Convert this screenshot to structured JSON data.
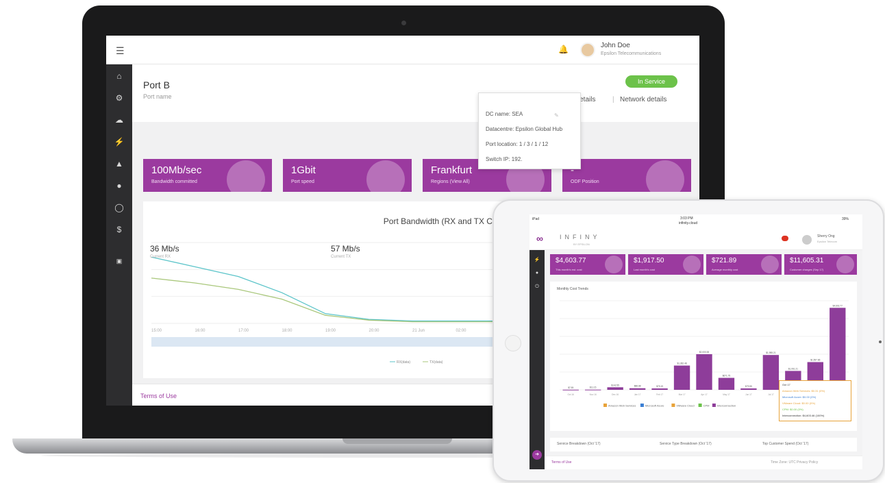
{
  "laptop": {
    "user": {
      "name": "John Doe",
      "company": "Epsilon Telecommunications"
    },
    "port": {
      "title": "Port B",
      "subtitle": "Port name"
    },
    "service_button": "In Service",
    "more_details": "More details",
    "network_details": "Network details",
    "popover": [
      "DC name: SEA",
      "Datacentre: Epsilon Global Hub",
      "Port location: 1 / 3 / 1 / 12",
      "Switch IP: 192."
    ],
    "stats": [
      {
        "value": "100Mb/sec",
        "label": "Bandwidth committed"
      },
      {
        "value": "1Gbit",
        "label": "Port speed"
      },
      {
        "value": "Frankfurt",
        "label": "Regions (View All)"
      },
      {
        "value": "-",
        "label": "ODF Position"
      }
    ],
    "chart_data": {
      "type": "line",
      "title": "Port Bandwidth (RX and TX Combined)",
      "x": [
        "15:00",
        "16:00",
        "17:00",
        "18:00",
        "19:00",
        "20:00",
        "21 Jun",
        "02:00",
        "03:00"
      ],
      "series": [
        {
          "name": "RX(data)",
          "values": [
            82,
            70,
            58,
            38,
            12,
            5,
            3,
            3,
            3
          ]
        },
        {
          "name": "TX(data)",
          "values": [
            56,
            50,
            42,
            30,
            10,
            4,
            2,
            2,
            2
          ]
        }
      ],
      "ylim": [
        0,
        100
      ]
    },
    "current": [
      {
        "value": "36 Mb/s",
        "label": "Current RX"
      },
      {
        "value": "57 Mb/s",
        "label": "Current TX"
      }
    ],
    "terms": "Terms of Use"
  },
  "tablet": {
    "status": {
      "left": "iPad",
      "time": "3:03 PM",
      "net": "infinity.cloud",
      "battery": "39%"
    },
    "brand": "INFINY",
    "brand_sub": "BY EPSILON",
    "user": {
      "name": "Sherry Ong",
      "company": "Epsilon Telecom"
    },
    "stats": [
      {
        "value": "$4,603.77",
        "label": "This month's est. cost"
      },
      {
        "value": "$1,917.50",
        "label": "Last month's cost"
      },
      {
        "value": "$721.89",
        "label": "Average monthly cost"
      },
      {
        "value": "$11,605.31",
        "label": "Customer charges (Sep 17)"
      }
    ],
    "chart_data": {
      "type": "bar",
      "title": "Monthly Cost Trends",
      "categories": [
        "Oct 16",
        "Nov 16",
        "Dec 16",
        "Jan 17",
        "Feb 17",
        "Mar 17",
        "Apr 17",
        "May 17",
        "Jun 17",
        "Jul 17",
        "Aug 17",
        "Sep 17",
        "Oct 17"
      ],
      "values": [
        7.55,
        11.15,
        142.55,
        88.88,
        79.19,
        1362.48,
        2000.38,
        671.75,
        79.55,
        1955.21,
        1061.21,
        1557.86,
        4603.77
      ],
      "data_labels": [
        "$7.55",
        "$11.15",
        "$142.55",
        "$88.88",
        "$79.19",
        "$1,362.48",
        "$2,000.38",
        "$671.75",
        "$79.55",
        "$1,955.21",
        "$1,061.21",
        "$1,557.86",
        "$4,603.77"
      ],
      "legend": [
        "Amazon Web Services",
        "Microsoft Azure",
        "VMware Cloud",
        "CPM",
        "Interconnection"
      ],
      "ylim": [
        0,
        5000
      ]
    },
    "tooltip": {
      "title": "Oct 17",
      "rows": [
        "Amazon Web Services: $0.31 (0%)",
        "Microsoft Azure: $0.00 (0%)",
        "VMware Cloud: $0.00 (0%)",
        "CPM: $0.00 (0%)",
        "Interconnection: $4,603.46 (100%)"
      ]
    },
    "bottom": [
      "Service Breakdown (Oct '17)",
      "Service Type Breakdown (Oct '17)",
      "Top Customer Spend (Oct '17)"
    ],
    "terms": "Terms of Use",
    "zone": "Time Zone: UTC  Privacy Policy"
  }
}
